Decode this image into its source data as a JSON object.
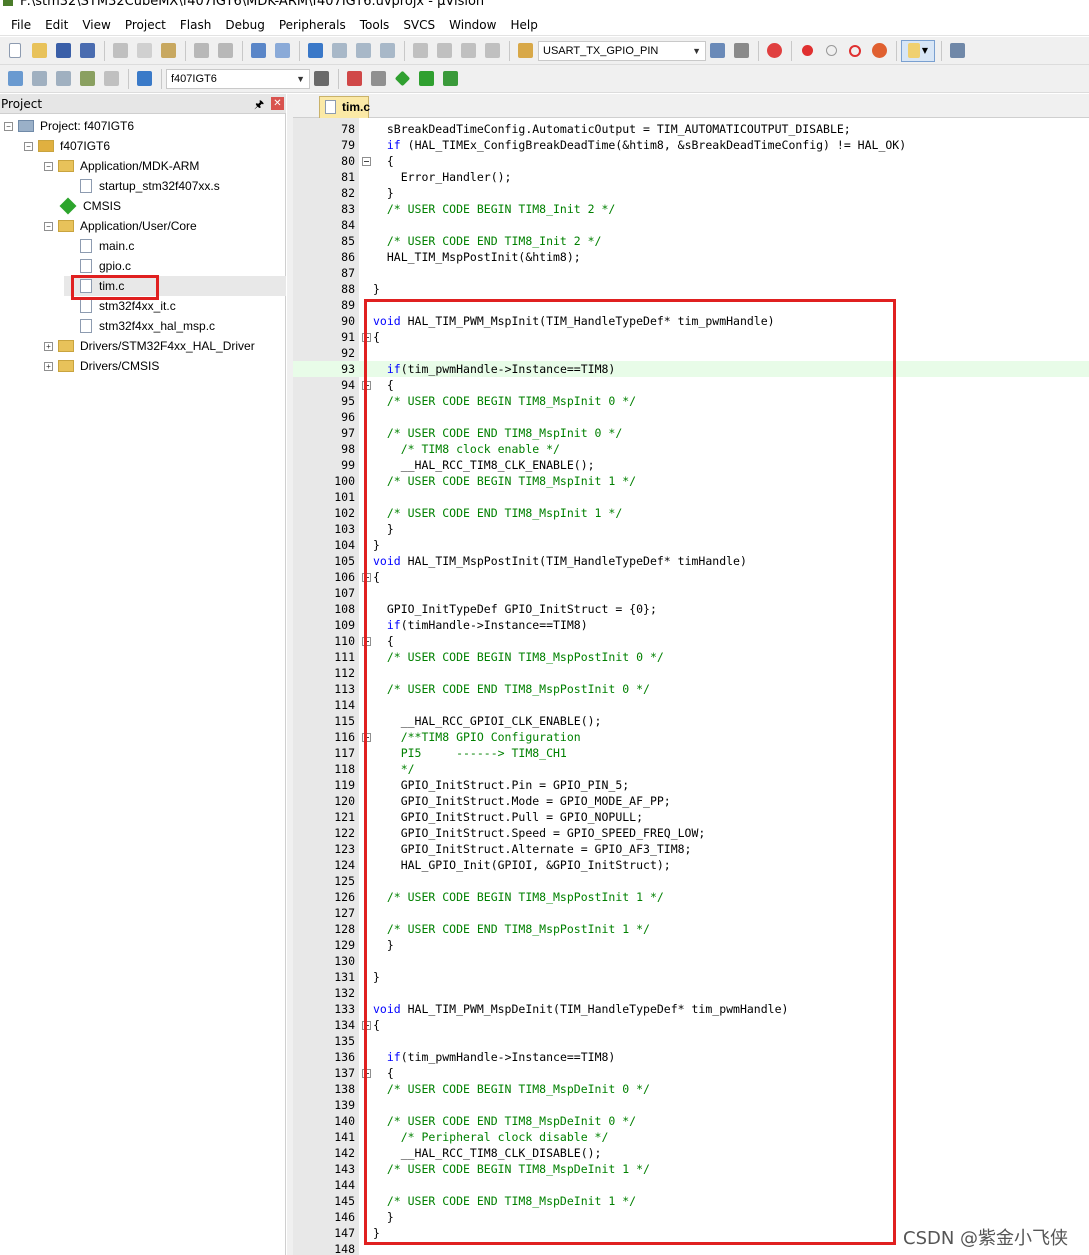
{
  "window": {
    "title": "F:\\stm32\\STM32CubeMX\\f407IGT6\\MDK-ARM\\f407IGT6.uvprojx - µVision"
  },
  "menu": [
    "File",
    "Edit",
    "View",
    "Project",
    "Flash",
    "Debug",
    "Peripherals",
    "Tools",
    "SVCS",
    "Window",
    "Help"
  ],
  "toolbar": {
    "find_combo": "USART_TX_GPIO_PIN",
    "target_combo": "f407IGT6"
  },
  "project_panel": {
    "title": "Project",
    "tree": [
      {
        "label": "Project: f407IGT6",
        "indent": 0,
        "kind": "project",
        "expander": "-"
      },
      {
        "label": "f407IGT6",
        "indent": 1,
        "kind": "target",
        "expander": "-"
      },
      {
        "label": "Application/MDK-ARM",
        "indent": 2,
        "kind": "folder",
        "expander": "-"
      },
      {
        "label": "startup_stm32f407xx.s",
        "indent": 3,
        "kind": "file",
        "expander": ""
      },
      {
        "label": "CMSIS",
        "indent": 2,
        "kind": "gem",
        "expander": ""
      },
      {
        "label": "Application/User/Core",
        "indent": 2,
        "kind": "folder",
        "expander": "-"
      },
      {
        "label": "main.c",
        "indent": 3,
        "kind": "file",
        "expander": ""
      },
      {
        "label": "gpio.c",
        "indent": 3,
        "kind": "file",
        "expander": ""
      },
      {
        "label": "tim.c",
        "indent": 3,
        "kind": "file",
        "expander": "",
        "selected": true
      },
      {
        "label": "stm32f4xx_it.c",
        "indent": 3,
        "kind": "file",
        "expander": ""
      },
      {
        "label": "stm32f4xx_hal_msp.c",
        "indent": 3,
        "kind": "file",
        "expander": ""
      },
      {
        "label": "Drivers/STM32F4xx_HAL_Driver",
        "indent": 2,
        "kind": "folder",
        "expander": "+"
      },
      {
        "label": "Drivers/CMSIS",
        "indent": 2,
        "kind": "folder",
        "expander": "+"
      }
    ]
  },
  "editor": {
    "tab": "tim.c",
    "lines": [
      {
        "n": "78",
        "t": "  sBreakDeadTimeConfig.AutomaticOutput = TIM_AUTOMATICOUTPUT_DISABLE;",
        "c": "n",
        "f": false
      },
      {
        "n": "79",
        "t": "  if (HAL_TIMEx_ConfigBreakDeadTime(&htim8, &sBreakDeadTimeConfig) != HAL_OK)",
        "c": "k",
        "f": false
      },
      {
        "n": "80",
        "t": "  {",
        "c": "n",
        "f": true
      },
      {
        "n": "81",
        "t": "    Error_Handler();",
        "c": "n",
        "f": false
      },
      {
        "n": "82",
        "t": "  }",
        "c": "n",
        "f": false
      },
      {
        "n": "83",
        "t": "  /* USER CODE BEGIN TIM8_Init 2 */",
        "c": "c",
        "f": false
      },
      {
        "n": "84",
        "t": "",
        "c": "n",
        "f": false
      },
      {
        "n": "85",
        "t": "  /* USER CODE END TIM8_Init 2 */",
        "c": "c",
        "f": false
      },
      {
        "n": "86",
        "t": "  HAL_TIM_MspPostInit(&htim8);",
        "c": "n",
        "f": false
      },
      {
        "n": "87",
        "t": "",
        "c": "n",
        "f": false
      },
      {
        "n": "88",
        "t": "}",
        "c": "n",
        "f": false
      },
      {
        "n": "89",
        "t": "",
        "c": "n",
        "f": false
      },
      {
        "n": "90",
        "t": "void HAL_TIM_PWM_MspInit(TIM_HandleTypeDef* tim_pwmHandle)",
        "c": "k",
        "f": false
      },
      {
        "n": "91",
        "t": "{",
        "c": "n",
        "f": true
      },
      {
        "n": "92",
        "t": "",
        "c": "n",
        "f": false
      },
      {
        "n": "93",
        "t": "  if(tim_pwmHandle->Instance==TIM8)",
        "c": "k",
        "f": false,
        "hl": true
      },
      {
        "n": "94",
        "t": "  {",
        "c": "n",
        "f": true
      },
      {
        "n": "95",
        "t": "  /* USER CODE BEGIN TIM8_MspInit 0 */",
        "c": "c",
        "f": false
      },
      {
        "n": "96",
        "t": "",
        "c": "n",
        "f": false
      },
      {
        "n": "97",
        "t": "  /* USER CODE END TIM8_MspInit 0 */",
        "c": "c",
        "f": false
      },
      {
        "n": "98",
        "t": "    /* TIM8 clock enable */",
        "c": "c",
        "f": false
      },
      {
        "n": "99",
        "t": "    __HAL_RCC_TIM8_CLK_ENABLE();",
        "c": "n",
        "f": false
      },
      {
        "n": "100",
        "t": "  /* USER CODE BEGIN TIM8_MspInit 1 */",
        "c": "c",
        "f": false
      },
      {
        "n": "101",
        "t": "",
        "c": "n",
        "f": false
      },
      {
        "n": "102",
        "t": "  /* USER CODE END TIM8_MspInit 1 */",
        "c": "c",
        "f": false
      },
      {
        "n": "103",
        "t": "  }",
        "c": "n",
        "f": false
      },
      {
        "n": "104",
        "t": "}",
        "c": "n",
        "f": false
      },
      {
        "n": "105",
        "t": "void HAL_TIM_MspPostInit(TIM_HandleTypeDef* timHandle)",
        "c": "k",
        "f": false
      },
      {
        "n": "106",
        "t": "{",
        "c": "n",
        "f": true
      },
      {
        "n": "107",
        "t": "",
        "c": "n",
        "f": false
      },
      {
        "n": "108",
        "t": "  GPIO_InitTypeDef GPIO_InitStruct = {0};",
        "c": "n",
        "f": false
      },
      {
        "n": "109",
        "t": "  if(timHandle->Instance==TIM8)",
        "c": "k",
        "f": false
      },
      {
        "n": "110",
        "t": "  {",
        "c": "n",
        "f": true
      },
      {
        "n": "111",
        "t": "  /* USER CODE BEGIN TIM8_MspPostInit 0 */",
        "c": "c",
        "f": false
      },
      {
        "n": "112",
        "t": "",
        "c": "n",
        "f": false
      },
      {
        "n": "113",
        "t": "  /* USER CODE END TIM8_MspPostInit 0 */",
        "c": "c",
        "f": false
      },
      {
        "n": "114",
        "t": "",
        "c": "n",
        "f": false
      },
      {
        "n": "115",
        "t": "    __HAL_RCC_GPIOI_CLK_ENABLE();",
        "c": "n",
        "f": false
      },
      {
        "n": "116",
        "t": "    /**TIM8 GPIO Configuration",
        "c": "c",
        "f": true
      },
      {
        "n": "117",
        "t": "    PI5     ------> TIM8_CH1",
        "c": "c",
        "f": false
      },
      {
        "n": "118",
        "t": "    */",
        "c": "c",
        "f": false
      },
      {
        "n": "119",
        "t": "    GPIO_InitStruct.Pin = GPIO_PIN_5;",
        "c": "n",
        "f": false
      },
      {
        "n": "120",
        "t": "    GPIO_InitStruct.Mode = GPIO_MODE_AF_PP;",
        "c": "n",
        "f": false
      },
      {
        "n": "121",
        "t": "    GPIO_InitStruct.Pull = GPIO_NOPULL;",
        "c": "n",
        "f": false
      },
      {
        "n": "122",
        "t": "    GPIO_InitStruct.Speed = GPIO_SPEED_FREQ_LOW;",
        "c": "n",
        "f": false
      },
      {
        "n": "123",
        "t": "    GPIO_InitStruct.Alternate = GPIO_AF3_TIM8;",
        "c": "n",
        "f": false
      },
      {
        "n": "124",
        "t": "    HAL_GPIO_Init(GPIOI, &GPIO_InitStruct);",
        "c": "n",
        "f": false
      },
      {
        "n": "125",
        "t": "",
        "c": "n",
        "f": false
      },
      {
        "n": "126",
        "t": "  /* USER CODE BEGIN TIM8_MspPostInit 1 */",
        "c": "c",
        "f": false
      },
      {
        "n": "127",
        "t": "",
        "c": "n",
        "f": false
      },
      {
        "n": "128",
        "t": "  /* USER CODE END TIM8_MspPostInit 1 */",
        "c": "c",
        "f": false
      },
      {
        "n": "129",
        "t": "  }",
        "c": "n",
        "f": false
      },
      {
        "n": "130",
        "t": "",
        "c": "n",
        "f": false
      },
      {
        "n": "131",
        "t": "}",
        "c": "n",
        "f": false
      },
      {
        "n": "132",
        "t": "",
        "c": "n",
        "f": false
      },
      {
        "n": "133",
        "t": "void HAL_TIM_PWM_MspDeInit(TIM_HandleTypeDef* tim_pwmHandle)",
        "c": "k",
        "f": false
      },
      {
        "n": "134",
        "t": "{",
        "c": "n",
        "f": true
      },
      {
        "n": "135",
        "t": "",
        "c": "n",
        "f": false
      },
      {
        "n": "136",
        "t": "  if(tim_pwmHandle->Instance==TIM8)",
        "c": "k",
        "f": false
      },
      {
        "n": "137",
        "t": "  {",
        "c": "n",
        "f": true
      },
      {
        "n": "138",
        "t": "  /* USER CODE BEGIN TIM8_MspDeInit 0 */",
        "c": "c",
        "f": false
      },
      {
        "n": "139",
        "t": "",
        "c": "n",
        "f": false
      },
      {
        "n": "140",
        "t": "  /* USER CODE END TIM8_MspDeInit 0 */",
        "c": "c",
        "f": false
      },
      {
        "n": "141",
        "t": "    /* Peripheral clock disable */",
        "c": "c",
        "f": false
      },
      {
        "n": "142",
        "t": "    __HAL_RCC_TIM8_CLK_DISABLE();",
        "c": "n",
        "f": false
      },
      {
        "n": "143",
        "t": "  /* USER CODE BEGIN TIM8_MspDeInit 1 */",
        "c": "c",
        "f": false
      },
      {
        "n": "144",
        "t": "",
        "c": "n",
        "f": false
      },
      {
        "n": "145",
        "t": "  /* USER CODE END TIM8_MspDeInit 1 */",
        "c": "c",
        "f": false
      },
      {
        "n": "146",
        "t": "  }",
        "c": "n",
        "f": false
      },
      {
        "n": "147",
        "t": "}",
        "c": "n",
        "f": false
      },
      {
        "n": "148",
        "t": "",
        "c": "n",
        "f": false
      }
    ]
  },
  "watermark": "CSDN @紫金小飞侠",
  "colors": {
    "keyword": "#0000ff",
    "comment": "#008000",
    "highlight_box": "#e02020",
    "current_line": "#e8fce8"
  }
}
